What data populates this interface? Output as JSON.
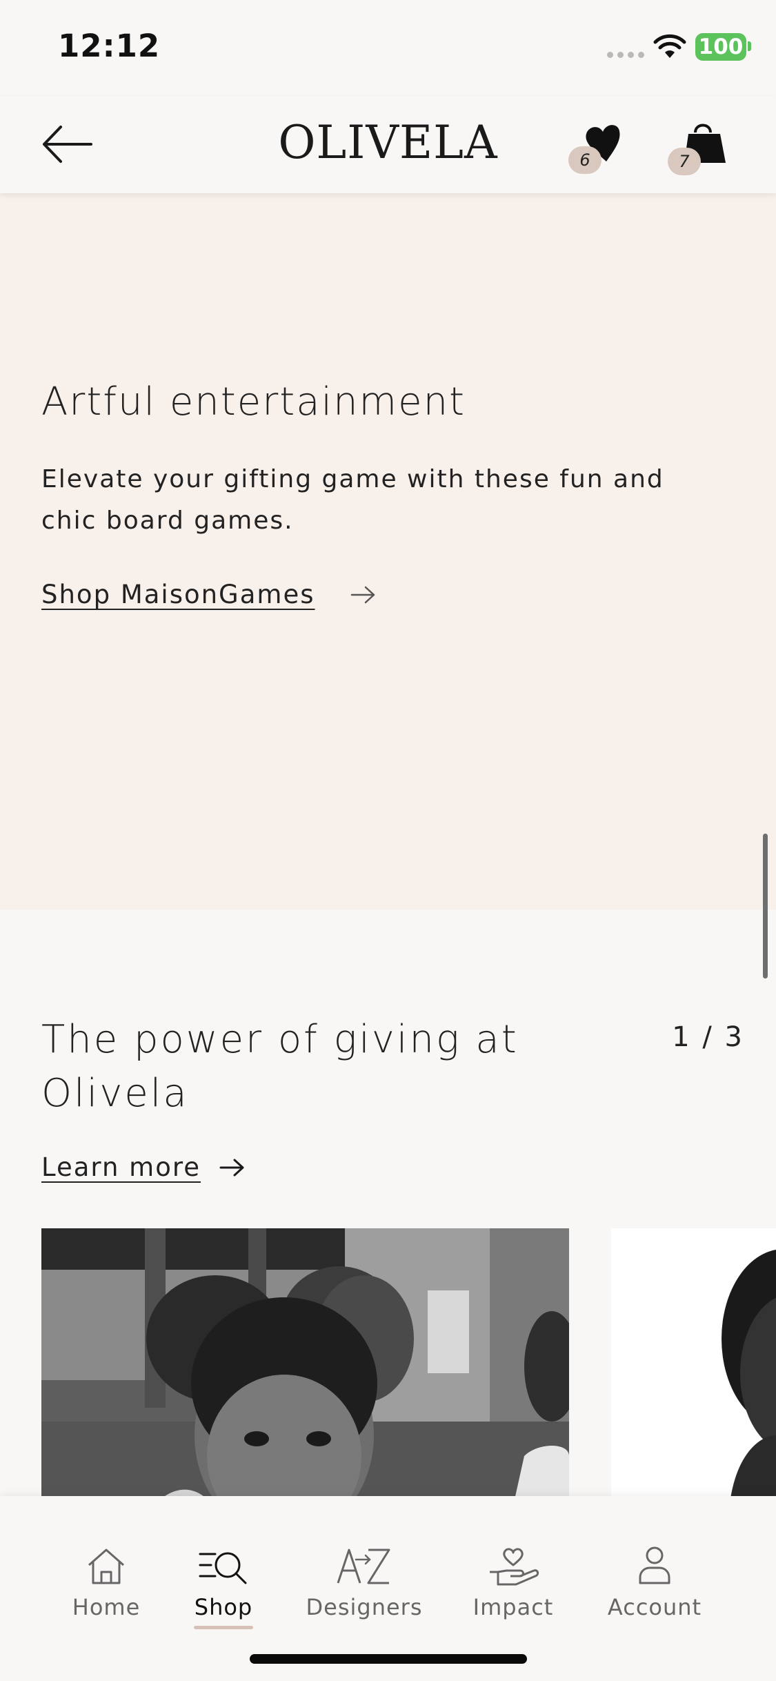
{
  "status": {
    "time": "12:12",
    "battery": "100"
  },
  "header": {
    "brand": "OLIVELA",
    "wishlist_count": "6",
    "bag_count": "7",
    "icons": [
      "back-arrow-icon",
      "heart-icon",
      "shopping-bag-icon"
    ]
  },
  "promo": {
    "title": "Artful entertainment",
    "description": "Elevate your gifting game with these fun and chic board games.",
    "link": "Shop MaisonGames"
  },
  "giving": {
    "title": "The power of giving at Olivela",
    "counter": "1 / 3",
    "link": "Learn more"
  },
  "tabs": [
    {
      "label": "Home",
      "icon": "home-icon"
    },
    {
      "label": "Shop",
      "icon": "shop-search-icon",
      "active": true
    },
    {
      "label": "Designers",
      "icon": "a-to-z-icon"
    },
    {
      "label": "Impact",
      "icon": "heart-hand-icon"
    },
    {
      "label": "Account",
      "icon": "person-icon"
    }
  ],
  "colors": {
    "promo_bg": "#f8f0eb",
    "page_bg": "#f9f7f5",
    "badge": "#d8c8bd",
    "battery": "#5cc35c",
    "active_tab_underline": "#d7c0b5"
  }
}
